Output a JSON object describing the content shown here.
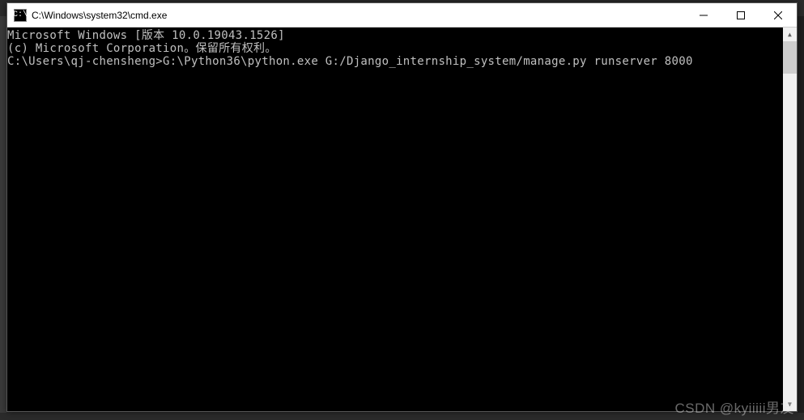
{
  "titlebar": {
    "icon_text": "C:\\",
    "title": "C:\\Windows\\system32\\cmd.exe",
    "minimize": "—",
    "maximize": "☐",
    "close": "✕"
  },
  "console": {
    "line1": "Microsoft Windows [版本 10.0.19043.1526]",
    "line2": "(c) Microsoft Corporation。保留所有权利。",
    "line3": "",
    "line4": "C:\\Users\\qj-chensheng>G:\\Python36\\python.exe G:/Django_internship_system/manage.py runserver 8000"
  },
  "scrollbar": {
    "up": "▲",
    "down": "▼"
  },
  "watermark": "CSDN @kyiiiii男友"
}
